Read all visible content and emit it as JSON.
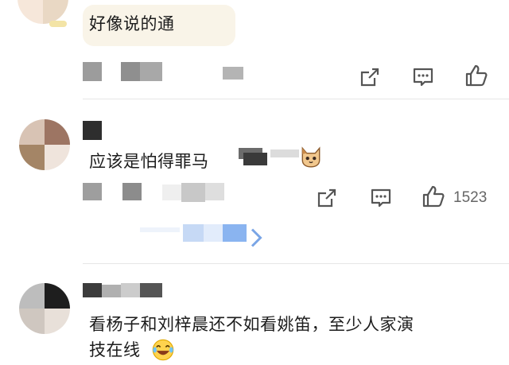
{
  "comments": [
    {
      "text": "好像说的通"
    },
    {
      "text": "应该是怕得罪马",
      "emoji": "cat-face-icon",
      "like_count": "1523"
    },
    {
      "text_line1": "看杨子和刘梓晨还不如看姚笛，至少人家演",
      "text_line2": "技在线",
      "emoji": "laughing-face-icon"
    }
  ],
  "actions": {
    "share_icon": "share-icon",
    "comment_icon": "comment-icon",
    "like_icon": "like-icon"
  },
  "colors": {
    "icon": "#555555",
    "divider": "#e6e6e6",
    "bubble": "#f9f4e8",
    "link": "#8ab4f0"
  }
}
